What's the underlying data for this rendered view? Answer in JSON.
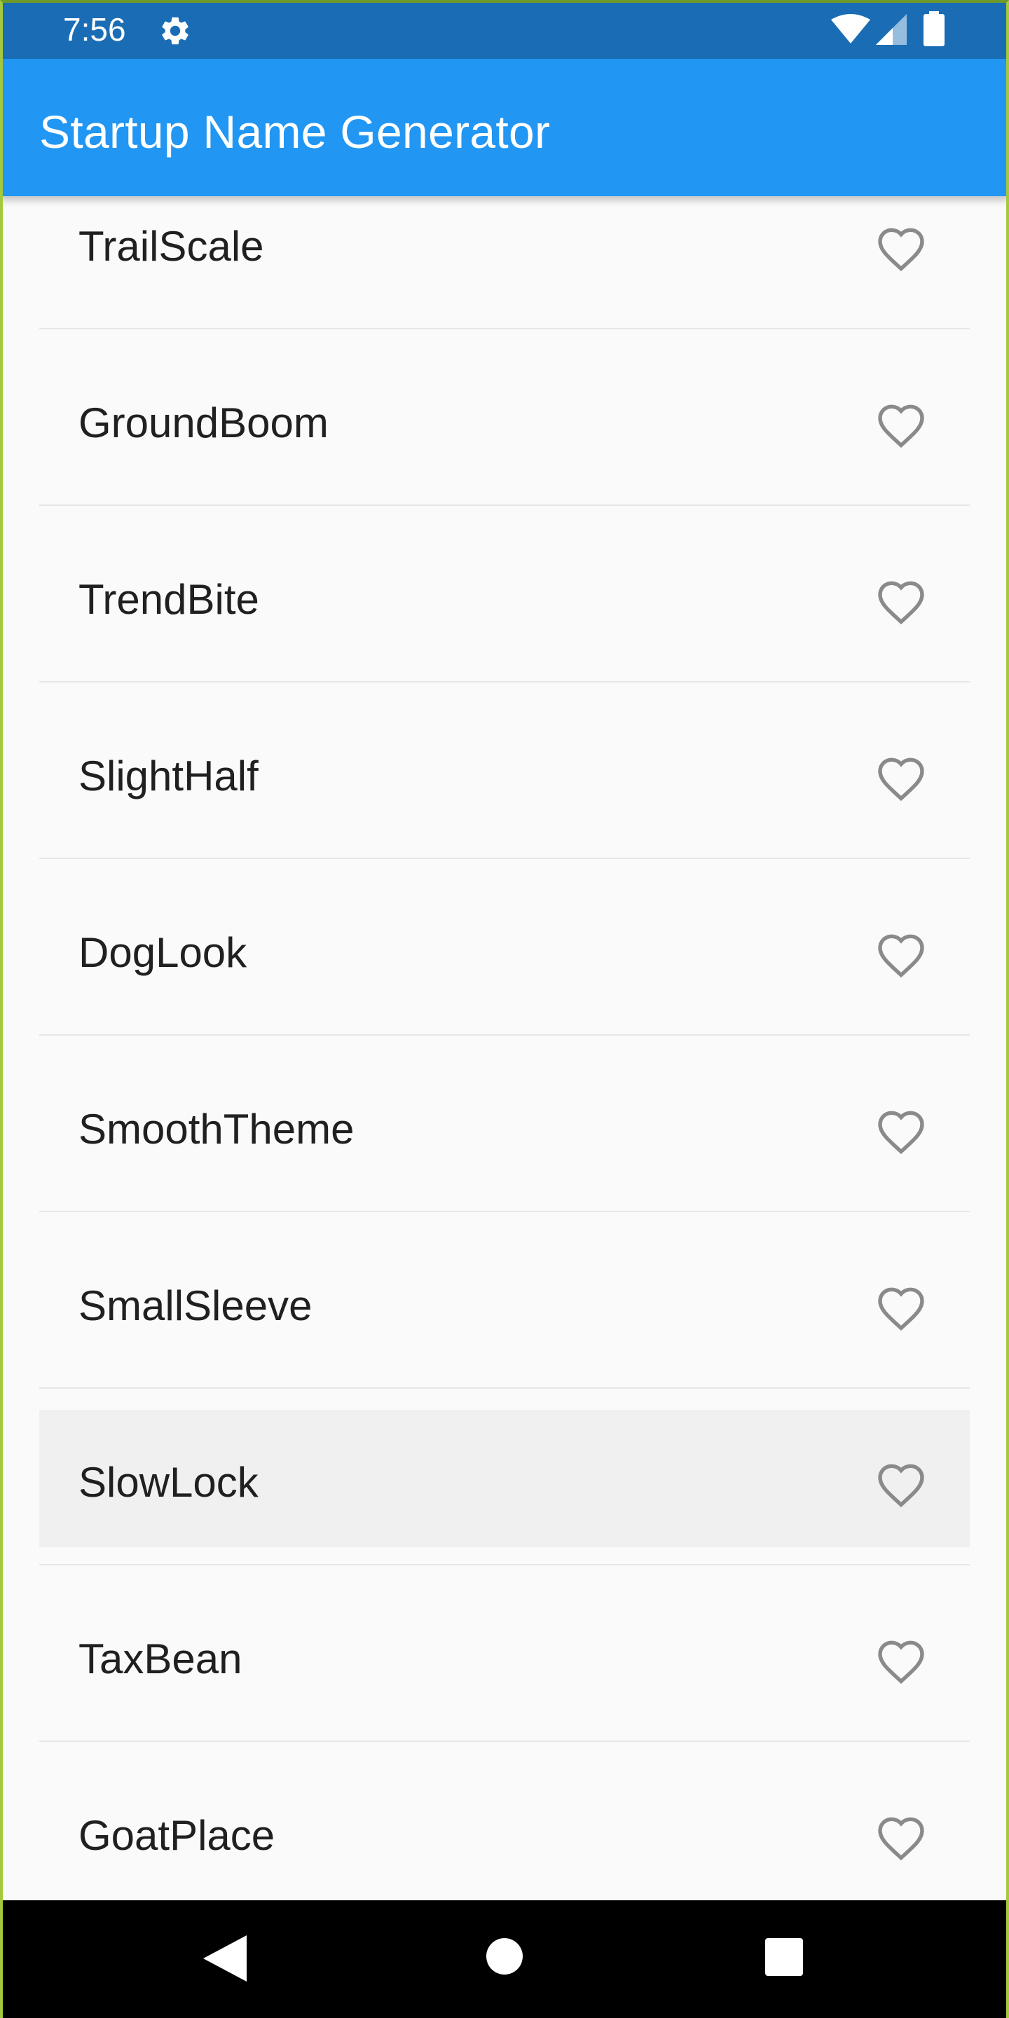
{
  "status_bar": {
    "time": "7:56",
    "icons": [
      "gear-icon",
      "wifi-icon",
      "cell-signal-icon",
      "battery-icon"
    ]
  },
  "app_bar": {
    "title": "Startup Name Generator",
    "color": "#2196f3"
  },
  "list": {
    "items": [
      {
        "name": "TrailScale",
        "saved": false,
        "icon": "heart-outline-icon"
      },
      {
        "name": "GroundBoom",
        "saved": false,
        "icon": "heart-outline-icon"
      },
      {
        "name": "TrendBite",
        "saved": false,
        "icon": "heart-outline-icon"
      },
      {
        "name": "SlightHalf",
        "saved": false,
        "icon": "heart-outline-icon"
      },
      {
        "name": "DogLook",
        "saved": false,
        "icon": "heart-outline-icon"
      },
      {
        "name": "SmoothTheme",
        "saved": false,
        "icon": "heart-outline-icon"
      },
      {
        "name": "SmallSleeve",
        "saved": false,
        "icon": "heart-outline-icon"
      },
      {
        "name": "SlowLock",
        "saved": false,
        "icon": "heart-outline-icon"
      },
      {
        "name": "TaxBean",
        "saved": false,
        "icon": "heart-outline-icon"
      },
      {
        "name": "GoatPlace",
        "saved": false,
        "icon": "heart-outline-icon"
      }
    ],
    "heart_color": "#8a8a8a",
    "pressed_item_index": 7
  },
  "nav_bar": {
    "icons": [
      "back-icon",
      "home-icon",
      "recents-icon"
    ]
  }
}
